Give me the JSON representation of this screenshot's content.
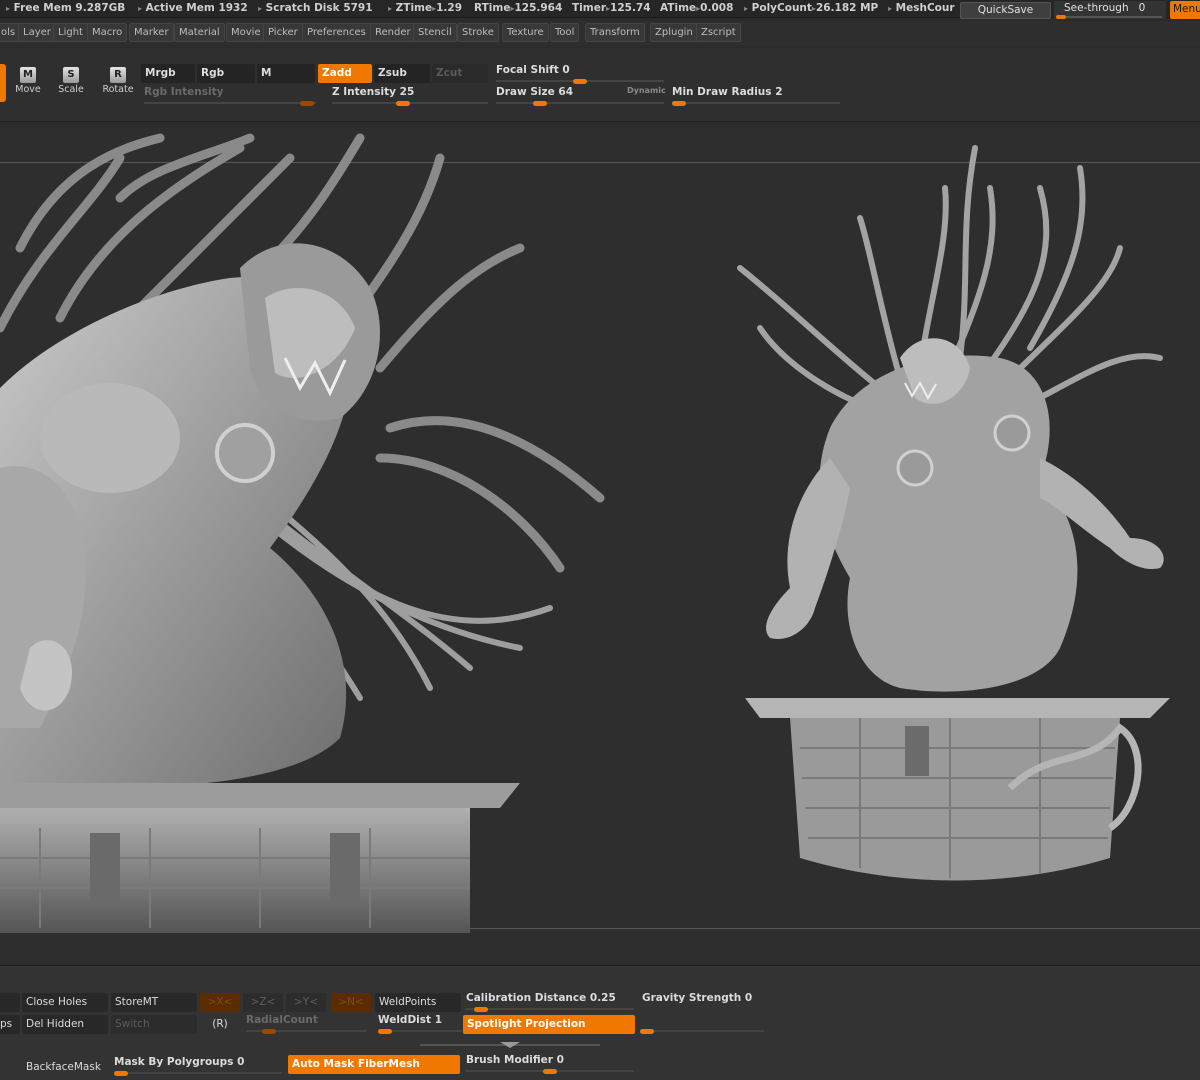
{
  "status": {
    "items": [
      {
        "label": "Free Mem",
        "value": "9.287GB"
      },
      {
        "label": "Active Mem",
        "value": "1932"
      },
      {
        "label": "Scratch Disk",
        "value": "5791"
      },
      {
        "label": "ZTime",
        "value": "1.29"
      },
      {
        "label": "RTime",
        "value": "125.964"
      },
      {
        "label": "Timer",
        "value": "125.74"
      },
      {
        "label": "ATime",
        "value": "0.008"
      },
      {
        "label": "PolyCount",
        "value": "26.182 MP"
      },
      {
        "label": "MeshCour",
        "value": ""
      }
    ],
    "quicksave": "QuickSave",
    "seethrough_label": "See-through",
    "seethrough_value": "0",
    "seethrough_level": 0,
    "menus": "Menu"
  },
  "menubar": {
    "items": [
      "ols",
      "Layer",
      "Light",
      "Macro",
      "Marker",
      "Material",
      "Movie",
      "Picker",
      "Preferences",
      "Render",
      "Stencil",
      "Stroke",
      "Texture",
      "Tool",
      "Transform",
      "Zplugin",
      "Zscript"
    ]
  },
  "shelf": {
    "move": "Move",
    "scale": "Scale",
    "rotate": "Rotate",
    "move_glyph": "M",
    "scale_glyph": "S",
    "rotate_glyph": "R",
    "mrgb": "Mrgb",
    "rgb": "Rgb",
    "m": "M",
    "zadd": "Zadd",
    "zsub": "Zsub",
    "zcut": "Zcut",
    "rgb_intensity": "Rgb Intensity",
    "z_intensity_label": "Z Intensity",
    "z_intensity_value": "25",
    "focal_shift_label": "Focal Shift",
    "focal_shift_value": "0",
    "draw_size_label": "Draw Size",
    "draw_size_value": "64",
    "dynamic": "Dynamic",
    "min_draw_radius_label": "Min Draw Radius",
    "min_draw_radius_value": "2"
  },
  "bottom": {
    "close_holes": "Close Holes",
    "store_mt": "StoreMT",
    "x_sym": ">X<",
    "z_sym": ">Z<",
    "y_sym": ">Y<",
    "n_sym": ">N<",
    "weld_points": "WeldPoints",
    "calibration_label": "Calibration Distance",
    "calibration_value": "0.25",
    "gravity_label": "Gravity Strength",
    "gravity_value": "0",
    "ps_fragment": "ps",
    "del_hidden": "Del Hidden",
    "switch": "Switch",
    "r_mark": "(R)",
    "radial_count": "RadialCount",
    "weld_dist_label": "WeldDist",
    "weld_dist_value": "1",
    "spotlight_projection": "Spotlight Projection",
    "backface_mask": "BackfaceMask",
    "mask_polygroups_label": "Mask By Polygroups",
    "mask_polygroups_value": "0",
    "auto_mask_fibermesh": "Auto Mask FiberMesh",
    "brush_modifier_label": "Brush Modifier",
    "brush_modifier_value": "0"
  },
  "colors": {
    "accent": "#f07800",
    "canvas": "#2e2e2e",
    "model": "#a9a9a9"
  }
}
